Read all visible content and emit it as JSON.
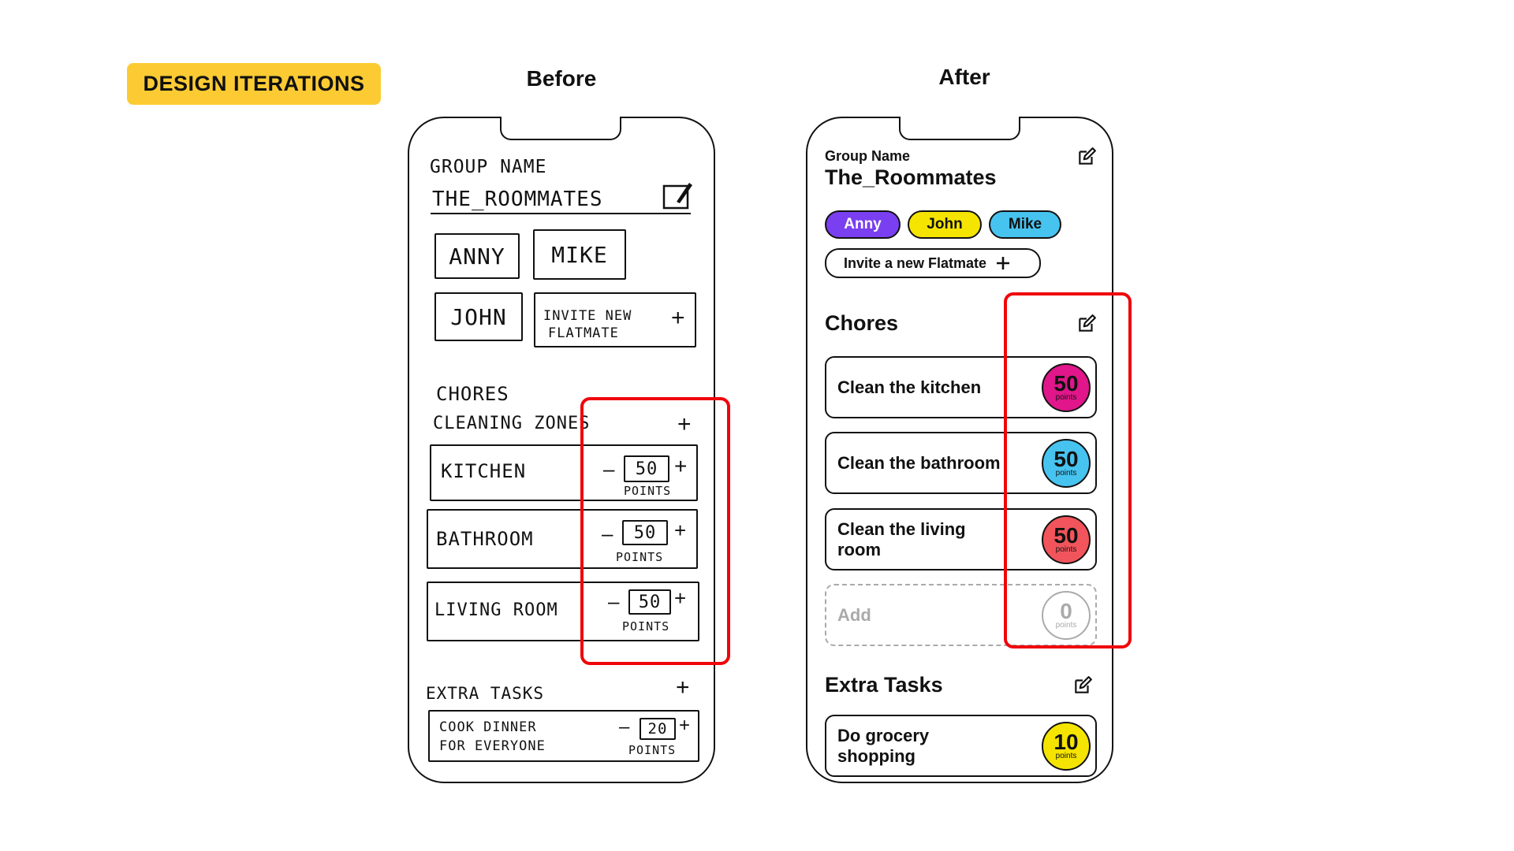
{
  "header": {
    "badge": "DESIGN ITERATIONS",
    "before_title": "Before",
    "after_title": "After"
  },
  "before": {
    "group_label": "GROUP NAME",
    "group_name": "THE_ROOMMATES",
    "members": [
      "ANNY",
      "MIKE",
      "JOHN"
    ],
    "invite_line1": "INVITE NEW",
    "invite_line2": "FLATMATE",
    "chores_title": "CHORES",
    "zones_title": "CLEANING ZONES",
    "points_unit": "POINTS",
    "chores": [
      {
        "name": "KITCHEN",
        "points": "50"
      },
      {
        "name": "BATHROOM",
        "points": "50"
      },
      {
        "name": "LIVING ROOM",
        "points": "50"
      }
    ],
    "extra_title": "EXTRA TASKS",
    "extra": {
      "line1": "COOK DINNER",
      "line2": "FOR EVERYONE",
      "points": "20"
    }
  },
  "after": {
    "group_label": "Group Name",
    "group_name": "The_Roommates",
    "members": [
      {
        "name": "Anny",
        "color": "#7A3FF0"
      },
      {
        "name": "John",
        "color": "#F5E400"
      },
      {
        "name": "Mike",
        "color": "#47C3F0"
      }
    ],
    "invite_label": "Invite a new Flatmate",
    "chores_title": "Chores",
    "points_unit": "points",
    "chores": [
      {
        "name": "Clean the kitchen",
        "points": "50",
        "color": "#E0168A"
      },
      {
        "name": "Clean the bathroom",
        "points": "50",
        "color": "#47C3F0"
      },
      {
        "name": "Clean the living room",
        "points": "50",
        "color": "#F2545B"
      }
    ],
    "add_label": "Add",
    "add_points": "0",
    "extra_title": "Extra Tasks",
    "extra": {
      "name": "Do grocery shopping",
      "points": "10",
      "color": "#F5E400"
    }
  },
  "icons": [
    "pencil-icon",
    "edit-icon",
    "plus-icon",
    "minus-icon"
  ]
}
